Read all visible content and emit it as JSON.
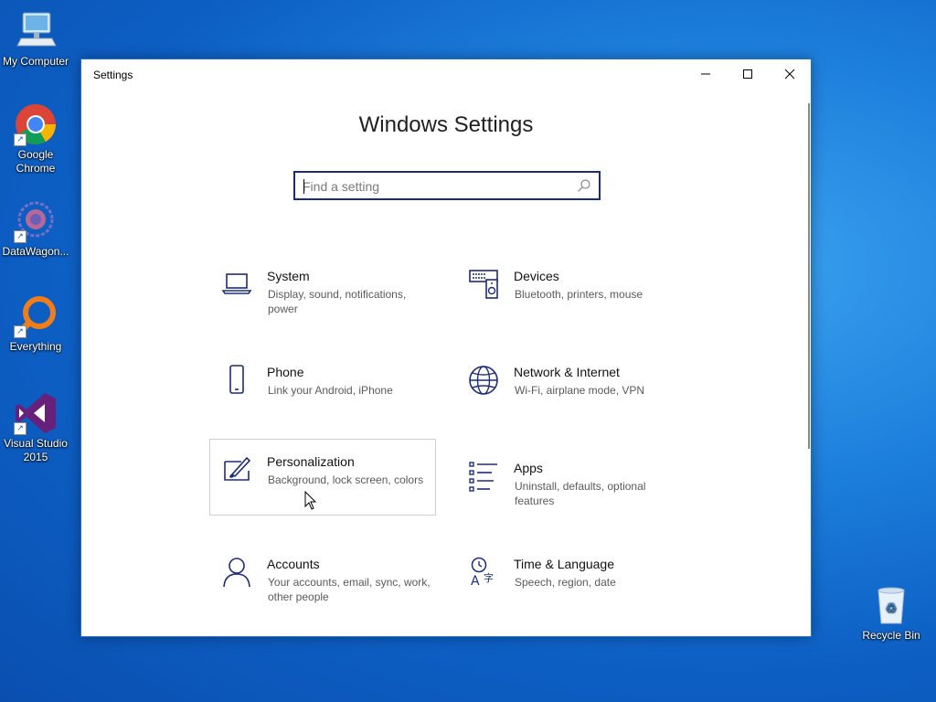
{
  "desktop": {
    "icons": [
      {
        "label": "My Computer",
        "icon": "computer-icon"
      },
      {
        "label": "Google Chrome",
        "icon": "chrome-icon"
      },
      {
        "label": "DataWagon...",
        "icon": "datawagon-icon"
      },
      {
        "label": "Everything",
        "icon": "everything-search-icon"
      },
      {
        "label": "Visual Studio 2015",
        "icon": "visual-studio-icon"
      },
      {
        "label": "Recycle Bin",
        "icon": "recycle-bin-icon"
      }
    ]
  },
  "window": {
    "title": "Settings",
    "heading": "Windows Settings",
    "search": {
      "placeholder": "Find a setting",
      "value": ""
    },
    "tiles": [
      {
        "name": "System",
        "desc": "Display, sound, notifications, power",
        "icon": "laptop-icon"
      },
      {
        "name": "Devices",
        "desc": "Bluetooth, printers, mouse",
        "icon": "devices-icon"
      },
      {
        "name": "Phone",
        "desc": "Link your Android, iPhone",
        "icon": "phone-icon"
      },
      {
        "name": "Network & Internet",
        "desc": "Wi-Fi, airplane mode, VPN",
        "icon": "globe-icon"
      },
      {
        "name": "Personalization",
        "desc": "Background, lock screen, colors",
        "icon": "personalization-icon"
      },
      {
        "name": "Apps",
        "desc": "Uninstall, defaults, optional features",
        "icon": "apps-list-icon"
      },
      {
        "name": "Accounts",
        "desc": "Your accounts, email, sync, work, other people",
        "icon": "person-icon"
      },
      {
        "name": "Time & Language",
        "desc": "Speech, region, date",
        "icon": "time-language-icon"
      }
    ]
  },
  "colors": {
    "accent": "#1b2d7a",
    "window_border": "#1a73c9",
    "desktop": "#0d5fc4"
  }
}
